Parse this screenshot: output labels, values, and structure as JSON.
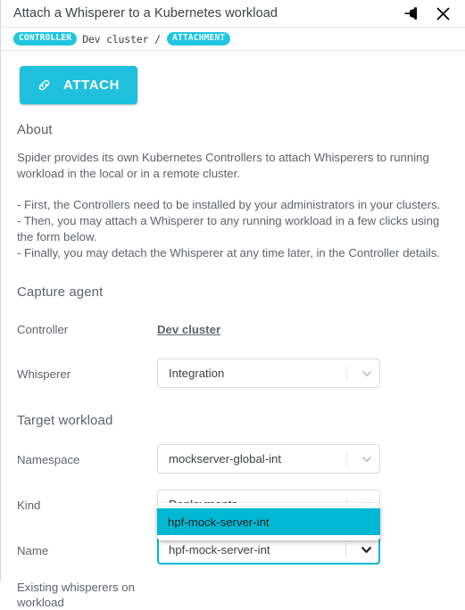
{
  "window": {
    "title": "Attach a Whisperer to a Kubernetes workload",
    "pin_icon": "pin-icon",
    "close_icon": "close-icon"
  },
  "breadcrumb": {
    "chip_controller": "CONTROLLER",
    "cluster": "Dev cluster",
    "separator": "/",
    "chip_attachment": "ATTACHMENT"
  },
  "toolbar": {
    "attach_label": "ATTACH",
    "attach_icon": "link-icon"
  },
  "about": {
    "heading": "About",
    "paragraph": "Spider provides its own Kubernetes Controllers to attach Whisperers to running workload in the local or in a remote cluster.",
    "bullets": [
      "- First, the Controllers need to be installed by your administrators in your clusters.",
      "- Then, you may attach a Whisperer to any running workload in a few clicks using the form below.",
      "- Finally, you may detach the Whisperer at any time later, in the Controller details."
    ]
  },
  "capture_agent": {
    "heading": "Capture agent",
    "controller": {
      "label": "Controller",
      "value": "Dev cluster"
    },
    "whisperer": {
      "label": "Whisperer",
      "value": "Integration"
    }
  },
  "target_workload": {
    "heading": "Target workload",
    "namespace": {
      "label": "Namespace",
      "value": "mockserver-global-int"
    },
    "kind": {
      "label": "Kind",
      "value": "Deployments"
    },
    "name": {
      "label": "Name",
      "value": "hpf-mock-server-int"
    },
    "existing_whisperers": {
      "label": "Existing whisperers on workload"
    }
  },
  "name_dropdown": {
    "options": [
      "hpf-mock-server-int"
    ],
    "selected_index": 0
  },
  "colors": {
    "accent": "#1ec0dd",
    "dropdown_highlight": "#00b8d4",
    "focus_border": "#00b8d4",
    "text": "#5f6368",
    "chip": "#1fc6e0"
  }
}
